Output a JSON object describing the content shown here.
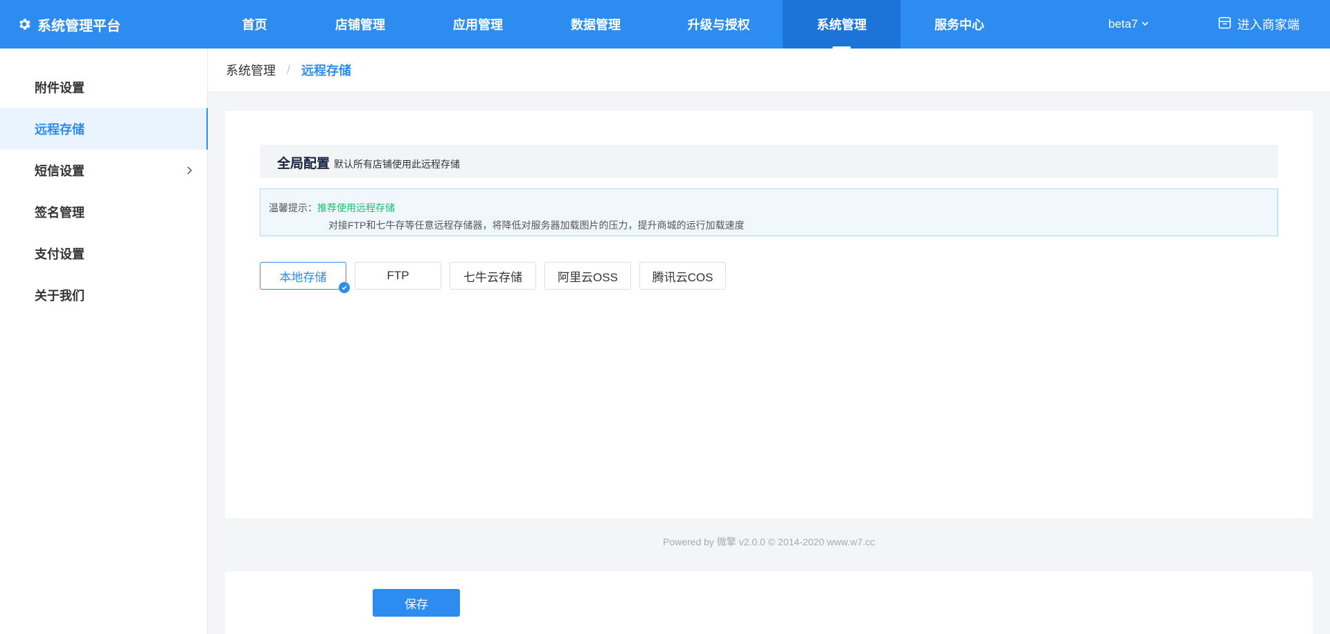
{
  "app": {
    "title": "系统管理平台",
    "icon": "gear-icon"
  },
  "nav": {
    "items": [
      {
        "label": "首页"
      },
      {
        "label": "店铺管理"
      },
      {
        "label": "应用管理"
      },
      {
        "label": "数据管理"
      },
      {
        "label": "升级与授权"
      },
      {
        "label": "系统管理",
        "active": true
      },
      {
        "label": "服务中心"
      }
    ],
    "version": "beta7",
    "merchant_label": "进入商家端"
  },
  "sidebar": {
    "items": [
      {
        "label": "附件设置"
      },
      {
        "label": "远程存储",
        "active": true
      },
      {
        "label": "短信设置",
        "has_children": true
      },
      {
        "label": "签名管理"
      },
      {
        "label": "支付设置"
      },
      {
        "label": "关于我们"
      }
    ]
  },
  "breadcrumb": {
    "parent": "系统管理",
    "separator": "/",
    "current": "远程存储"
  },
  "section": {
    "title": "全局配置",
    "subtitle": "默认所有店铺使用此远程存储"
  },
  "tip": {
    "label": "温馨提示：",
    "highlight": "推荐使用远程存储",
    "detail": "对接FTP和七牛存等任意远程存储器，将降低对服务器加载图片的压力，提升商城的运行加载速度"
  },
  "storage_options": {
    "options": [
      {
        "label": "本地存储",
        "selected": true
      },
      {
        "label": "FTP"
      },
      {
        "label": "七牛云存储"
      },
      {
        "label": "阿里云OSS"
      },
      {
        "label": "腾讯云COS"
      }
    ]
  },
  "footer": {
    "text": "Powered by 微擎 v2.0.0 © 2014-2020 www.w7.cc"
  },
  "actions": {
    "save_label": "保存"
  },
  "colors": {
    "primary": "#2d8cf0",
    "nav_active": "#1c74d9",
    "success": "#19be6b"
  }
}
